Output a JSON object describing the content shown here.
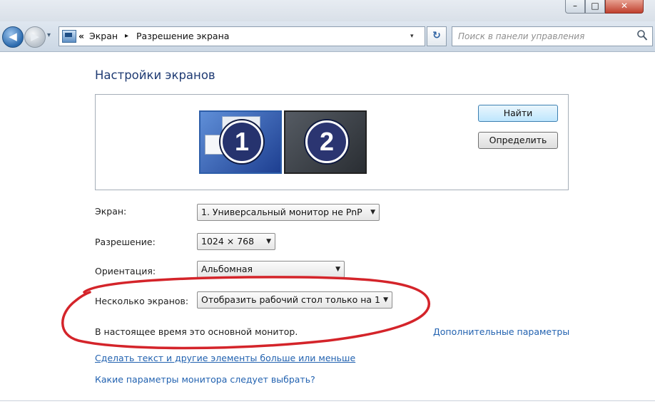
{
  "window": {
    "caption": {
      "minimize_icon": "minimize-icon",
      "maximize_icon": "maximize-icon",
      "close_icon": "close-icon",
      "minimize_glyph": "–",
      "maximize_glyph": "□",
      "close_glyph": "✕"
    }
  },
  "navigation": {
    "back_glyph": "◀",
    "forward_glyph": "▶",
    "history_glyph": "▾",
    "breadcrumb": {
      "lead": "«",
      "items": [
        "Экран",
        "Разрешение экрана"
      ],
      "separator": "▸"
    },
    "address_dropdown_glyph": "▾",
    "refresh_glyph": "↻",
    "search": {
      "placeholder": "Поиск в панели управления"
    }
  },
  "page": {
    "title": "Настройки экранов",
    "monitors": [
      {
        "number": "1",
        "selected": true
      },
      {
        "number": "2",
        "selected": false
      }
    ],
    "detect_button": "Найти",
    "identify_button": "Определить",
    "fields": {
      "display": {
        "label": "Экран:",
        "value": "1. Универсальный монитор не PnP"
      },
      "resolution": {
        "label": "Разрешение:",
        "value": "1024 × 768"
      },
      "orientation": {
        "label": "Ориентация:",
        "value": "Альбомная"
      },
      "multiple": {
        "label": "Несколько экранов:",
        "value": "Отобразить рабочий стол только на 1"
      }
    },
    "main_monitor_text": "В настоящее время это основной монитор.",
    "advanced_link": "Дополнительные параметры",
    "text_size_link": "Сделать текст и другие элементы больше или меньше",
    "which_params_link": "Какие параметры монитора следует выбрать?"
  },
  "colors": {
    "accent": "#2262b0",
    "title": "#1f3b73",
    "highlight": "#d4242a"
  },
  "select_arrow_glyph": "▼"
}
